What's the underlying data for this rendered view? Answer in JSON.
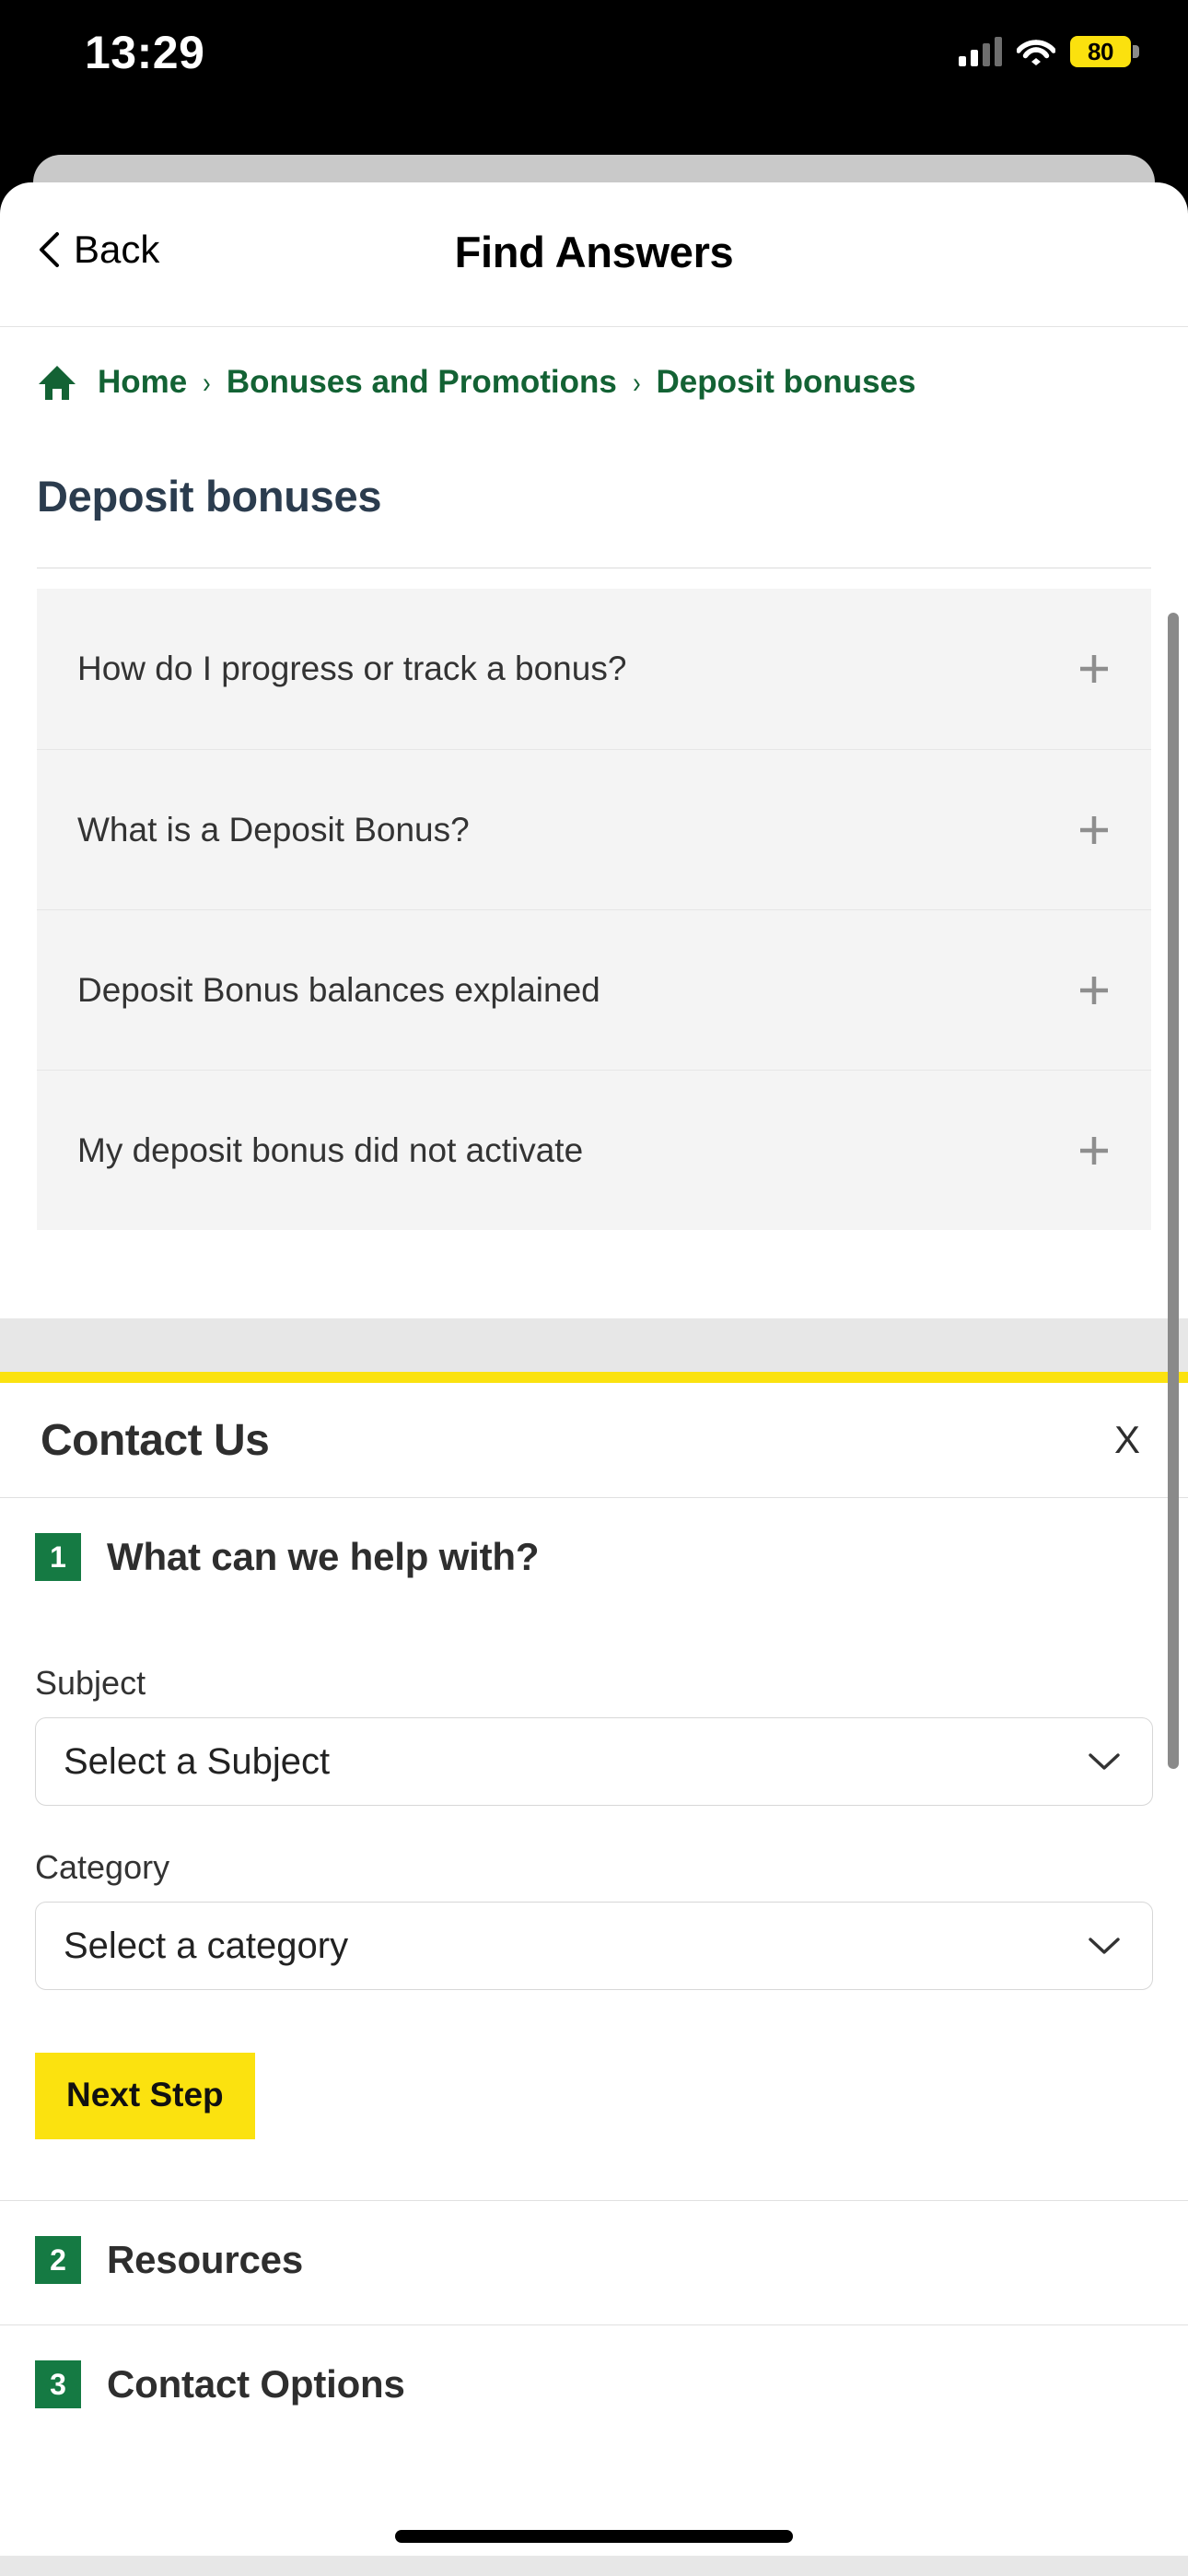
{
  "status_bar": {
    "time": "13:29",
    "battery_percent": "80",
    "battery_color": "#fbe10e",
    "signal_icon": "cellular-signal-icon",
    "wifi_icon": "wifi-icon",
    "battery_icon": "battery-icon"
  },
  "nav": {
    "back_label": "Back",
    "back_icon": "chevron-left-icon",
    "title": "Find Answers"
  },
  "breadcrumb": {
    "home_icon": "home-icon",
    "separator": "›",
    "items": [
      {
        "label": "Home"
      },
      {
        "label": "Bonuses and Promotions"
      },
      {
        "label": "Deposit bonuses"
      }
    ],
    "color": "#136234"
  },
  "page": {
    "title": "Deposit bonuses",
    "title_color": "#2b3c4e"
  },
  "accordion": {
    "expand_icon": "plus-icon",
    "items": [
      {
        "question": "How do I progress or track a bonus?"
      },
      {
        "question": "What is a Deposit Bonus?"
      },
      {
        "question": "Deposit Bonus balances explained"
      },
      {
        "question": "My deposit bonus did not activate"
      }
    ]
  },
  "contact_panel": {
    "accent_rule_color": "#fbe20f",
    "title": "Contact Us",
    "close_label": "X",
    "close_icon": "close-icon",
    "steps": [
      {
        "number": "1",
        "title": "What can we help with?",
        "fields": [
          {
            "label": "Subject",
            "value": "Select a Subject",
            "icon": "chevron-down-icon"
          },
          {
            "label": "Category",
            "value": "Select a category",
            "icon": "chevron-down-icon"
          }
        ],
        "button": "Next Step"
      },
      {
        "number": "2",
        "title": "Resources"
      },
      {
        "number": "3",
        "title": "Contact Options"
      }
    ],
    "step_badge_color": "#157a43",
    "button_color": "#fbe20f"
  }
}
